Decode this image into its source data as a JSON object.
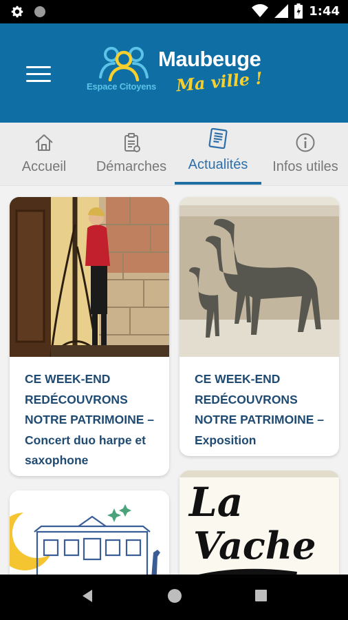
{
  "status_bar": {
    "time": "1:44",
    "icons": [
      "settings-icon",
      "circle-indicator-icon",
      "wifi-icon",
      "signal-icon",
      "battery-icon"
    ]
  },
  "header": {
    "logo_caption": "Espace Citoyens",
    "logo_title": "Maubeuge",
    "logo_subtitle": "Ma ville !",
    "menu_icon": "hamburger-menu-icon"
  },
  "tabs": [
    {
      "label": "Accueil",
      "icon": "home-icon",
      "active": false
    },
    {
      "label": "Démarches",
      "icon": "clipboard-icon",
      "active": false
    },
    {
      "label": "Actualités",
      "icon": "newspaper-icon",
      "active": true
    },
    {
      "label": "Infos utiles",
      "icon": "info-icon",
      "active": false
    }
  ],
  "news": [
    {
      "title": "CE WEEK-END REDÉCOUVRONS NOTRE PATRIMOINE – Concert duo harpe et saxophone",
      "image": "harpist-photo"
    },
    {
      "title": "CE WEEK-END REDÉCOUVRONS NOTRE PATRIMOINE – Exposition",
      "image": "camel-sculptures-photo"
    },
    {
      "title": "",
      "image": "night-building-illustration"
    },
    {
      "title": "",
      "image": "la-vache-poster",
      "poster_text": [
        "La",
        "Vache"
      ]
    }
  ],
  "nav_bar": [
    "back-icon",
    "home-circle-icon",
    "recents-icon"
  ],
  "colors": {
    "header_bg": "#0f6fa4",
    "accent": "#1f6ea3",
    "title_text": "#1f4a72",
    "logo_yellow": "#f7cf2e",
    "logo_cyan": "#5cc3e8"
  }
}
